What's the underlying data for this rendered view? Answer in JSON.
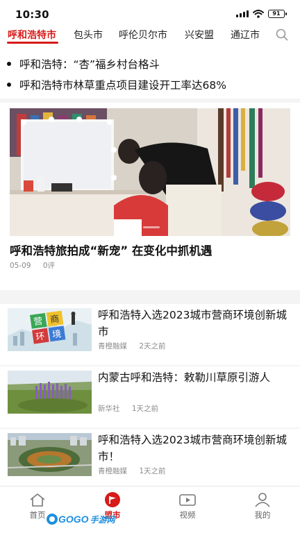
{
  "status_bar": {
    "time": "10:30",
    "battery": "91"
  },
  "tabs": [
    {
      "label": "呼和浩特市",
      "active": true
    },
    {
      "label": "包头市"
    },
    {
      "label": "呼伦贝尔市"
    },
    {
      "label": "兴安盟"
    },
    {
      "label": "通辽市"
    }
  ],
  "headlines": [
    "呼和浩特：“杏”福乡村台格斗",
    "呼和浩特市林草重点项目建设开工率达68%"
  ],
  "featured": {
    "title": "呼和浩特旅拍成“新宠” 在变化中抓机遇",
    "date": "05-09",
    "comments": "0评"
  },
  "news": [
    {
      "title": "呼和浩特入选2023城市营商环境创新城市",
      "source": "青橙融媒",
      "time": "2天之前",
      "thumb_text": [
        "营",
        "商",
        "环",
        "境"
      ]
    },
    {
      "title": "内蒙古呼和浩特：敕勒川草原引游人",
      "source": "新华社",
      "time": "1天之前"
    },
    {
      "title": "呼和浩特入选2023城市营商环境创新城市！",
      "source": "青橙融媒",
      "time": "1天之前"
    }
  ],
  "bottom_nav": [
    {
      "label": "首页",
      "icon": "home-icon"
    },
    {
      "label": "盟市",
      "icon": "flag-icon",
      "active": true
    },
    {
      "label": "视频",
      "icon": "video-icon"
    },
    {
      "label": "我的",
      "icon": "user-icon"
    }
  ],
  "watermark": {
    "brand": "GOGO",
    "suffix": "手游网"
  },
  "colors": {
    "accent": "#d71a1a",
    "meta": "#8a8a8a",
    "band": "#f4f4f4"
  }
}
